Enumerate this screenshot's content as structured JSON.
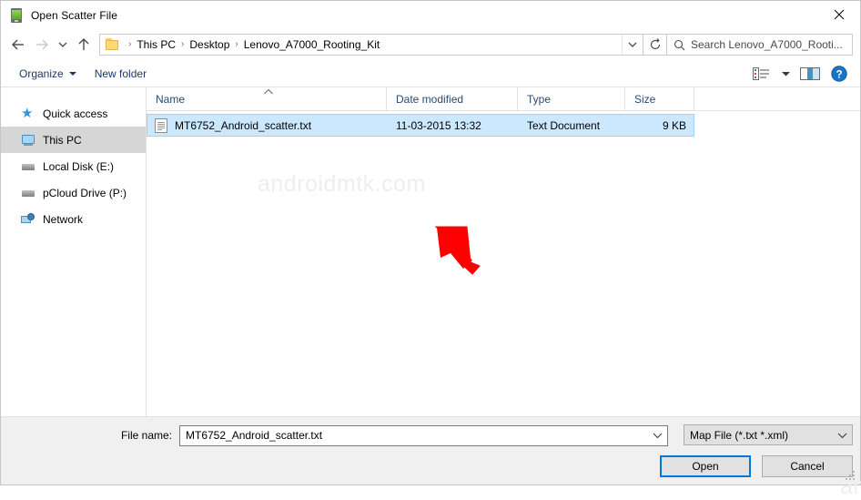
{
  "window": {
    "title": "Open Scatter File",
    "title_icon": "device-icon",
    "close_icon": "close-icon"
  },
  "nav": {
    "back_icon": "back-arrow-icon",
    "forward_icon": "forward-arrow-icon",
    "recent_icon": "recent-locations-chevron-icon",
    "up_icon": "up-arrow-icon",
    "folder_icon": "folder-icon",
    "breadcrumbs": [
      "This PC",
      "Desktop",
      "Lenovo_A7000_Rooting_Kit"
    ],
    "separator": "›",
    "address_dropdown_icon": "chevron-down-icon",
    "refresh_icon": "refresh-icon",
    "search_icon": "search-icon",
    "search_placeholder": "Search Lenovo_A7000_Rooti..."
  },
  "toolbar": {
    "organize_label": "Organize",
    "new_folder_label": "New folder",
    "view_icon": "view-layout-icon",
    "view_caret_icon": "chevron-down-icon",
    "preview_pane_icon": "preview-pane-icon",
    "help_icon": "help-icon"
  },
  "sidebar": {
    "items": [
      {
        "label": "Quick access",
        "icon": "star-icon",
        "selected": false
      },
      {
        "label": "This PC",
        "icon": "monitor-icon",
        "selected": true
      },
      {
        "label": "Local Disk (E:)",
        "icon": "drive-icon",
        "selected": false
      },
      {
        "label": "pCloud Drive (P:)",
        "icon": "drive-icon",
        "selected": false
      },
      {
        "label": "Network",
        "icon": "network-icon",
        "selected": false
      }
    ]
  },
  "filelist": {
    "columns": [
      "Name",
      "Date modified",
      "Type",
      "Size"
    ],
    "sort_column": "Name",
    "sort_direction": "ascending",
    "sort_icon": "chevron-up-icon",
    "rows": [
      {
        "name": "MT6752_Android_scatter.txt",
        "date_modified": "11-03-2015 13:32",
        "type": "Text Document",
        "size": "9 KB",
        "icon": "text-document-icon",
        "selected": true
      }
    ]
  },
  "annotation": {
    "arrow_icon": "red-arrow-icon",
    "arrow_color": "#ff0000"
  },
  "watermarks": {
    "top": "androidmtk.com",
    "bottom": "androidmtk.com"
  },
  "footer": {
    "file_name_label": "File name:",
    "file_name_value": "MT6752_Android_scatter.txt",
    "file_name_dropdown_icon": "chevron-down-icon",
    "filter_value": "Map File (*.txt *.xml)",
    "filter_dropdown_icon": "chevron-down-icon",
    "open_label": "Open",
    "cancel_label": "Cancel",
    "resize_grip_icon": "resize-grip-icon"
  },
  "colors": {
    "accent": "#0078d7",
    "selection_fill": "#cce8ff",
    "selection_border": "#99d1ff",
    "sidebar_selected": "#d6d6d6",
    "footer_bg": "#f0f0f0",
    "column_header_text": "#2b4a6f",
    "toolbar_text": "#1a3a66",
    "annotation": "#ff0000",
    "watermark": "#eeeeee"
  }
}
